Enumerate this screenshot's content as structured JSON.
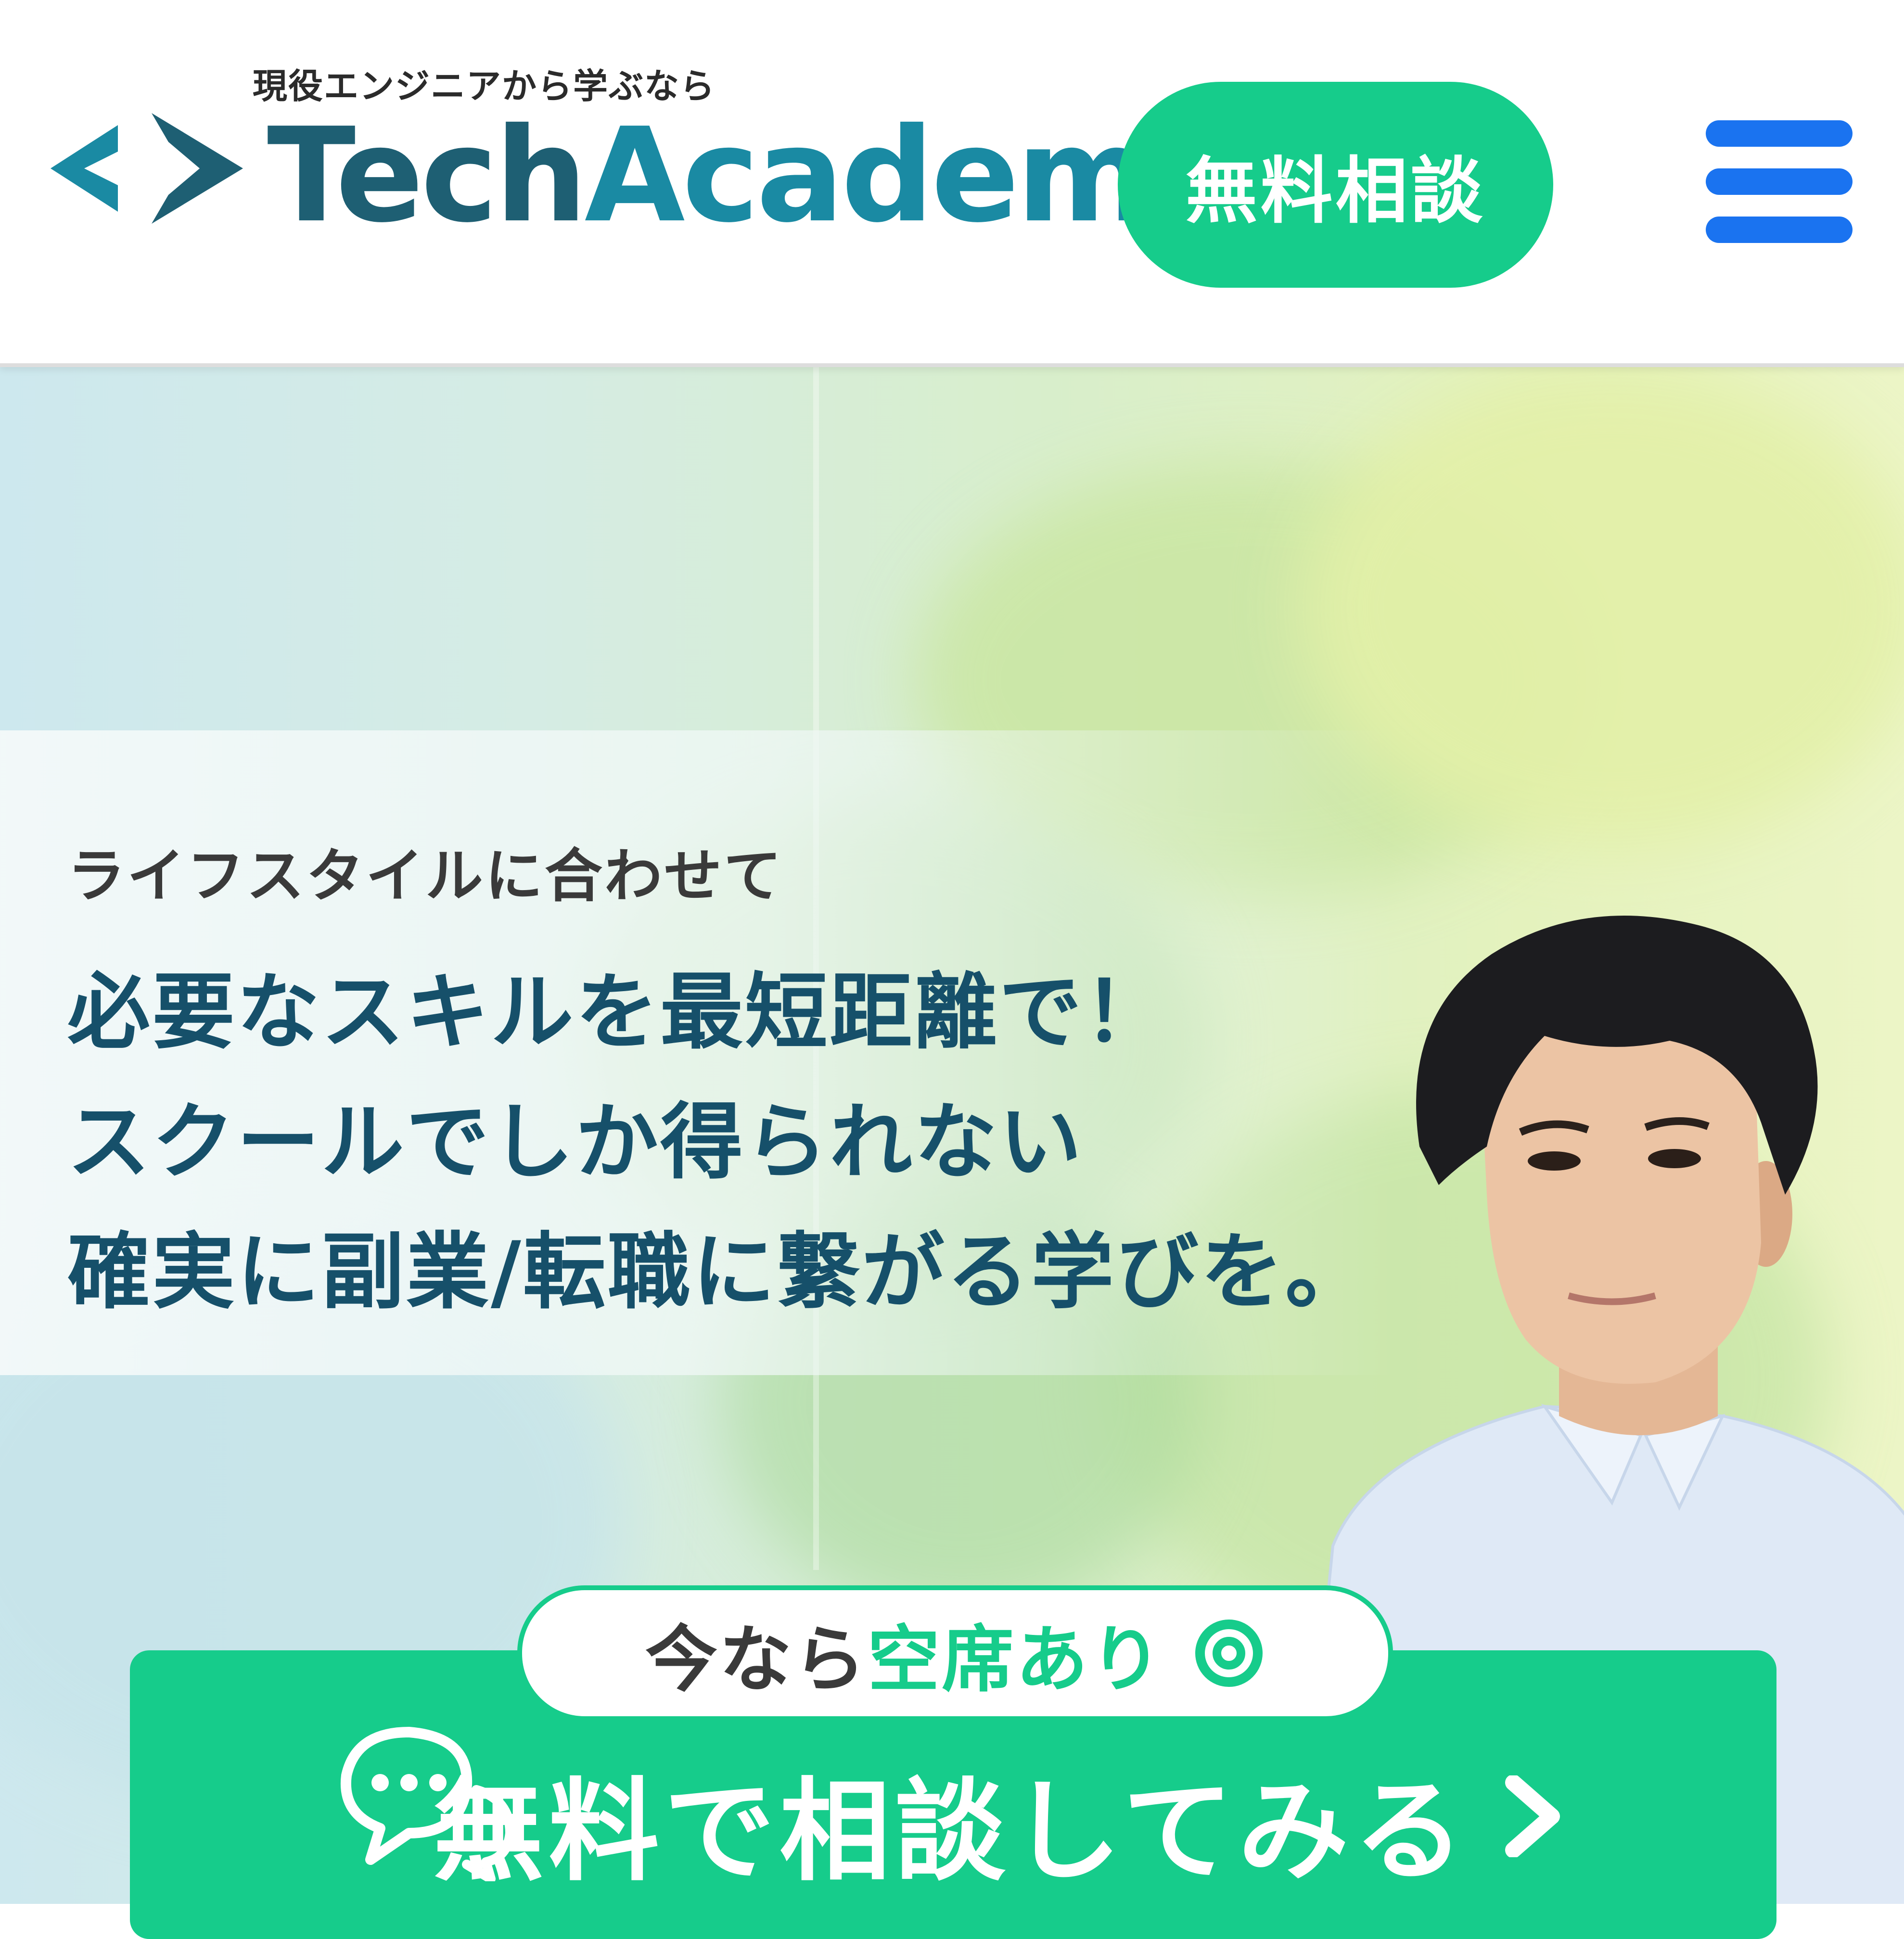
{
  "header": {
    "tagline": "現役エンジニアから学ぶなら",
    "logo_tech": "Tech",
    "logo_academy": "Academy",
    "cta_label": "無料相談"
  },
  "hero": {
    "subheading": "ライフスタイルに合わせて",
    "lines": [
      "必要なスキルを最短距離で！",
      "スクールでしか得られない",
      "確実に副業/転職に繋がる学びを。"
    ]
  },
  "cta": {
    "badge_prefix": "今なら",
    "badge_highlight": "空席あり",
    "main_label": "無料で相談してみる"
  },
  "colors": {
    "brand_green": "#16cc8b",
    "logo_dark": "#1e5f73",
    "logo_teal": "#1a8aa3",
    "menu_blue": "#1a73f0",
    "headline": "#16506a"
  },
  "icons": [
    "logo-mark-icon",
    "hamburger-menu-icon",
    "chat-bubbles-icon",
    "chevron-right-icon",
    "double-circle-icon"
  ]
}
